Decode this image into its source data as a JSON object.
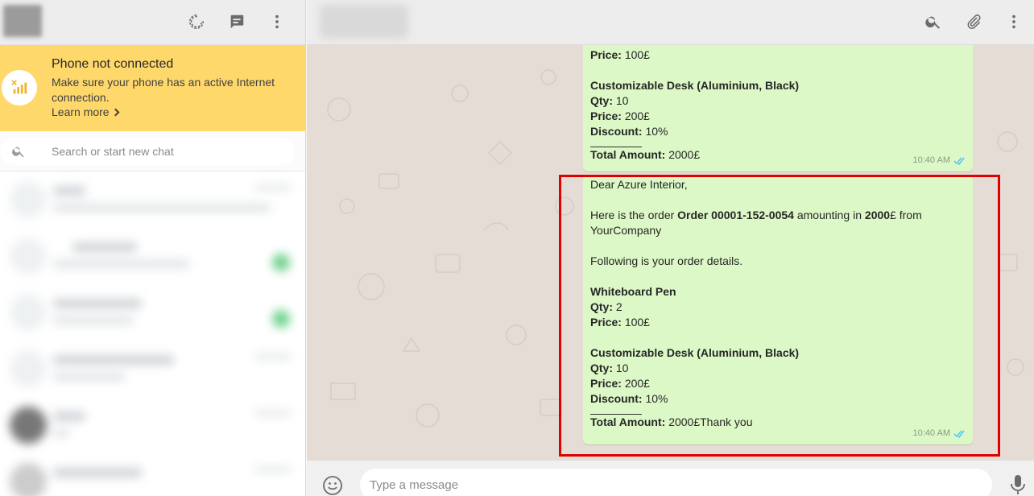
{
  "sidebar": {
    "notice": {
      "title": "Phone not connected",
      "body": "Make sure your phone has an active Internet connection.",
      "link": "Learn more"
    },
    "search": {
      "placeholder": "Search or start new chat"
    },
    "header_icons": [
      "status-icon",
      "new-chat-icon",
      "menu-icon"
    ]
  },
  "conversation": {
    "header_icons": [
      "search-icon",
      "attach-icon",
      "menu-icon"
    ],
    "messages": [
      {
        "price_top_label": "Price:",
        "price_top_value": "100£",
        "item2_name": "Customizable Desk (Aluminium, Black)",
        "qty_label": "Qty:",
        "qty_value": "10",
        "price_label": "Price:",
        "price_value": "200£",
        "discount_label": "Discount:",
        "discount_value": "10%",
        "total_label": "Total Amount:",
        "total_value": "2000£",
        "time": "10:40 AM"
      },
      {
        "greeting": "Dear Azure Interior,",
        "line1_pre": "Here is the order ",
        "order_ref": "Order 00001-152-0054",
        "line1_mid": " amounting in ",
        "amount": "2000",
        "line1_post": "£ from YourCompany",
        "details_intro": "Following is your order details.",
        "item1_name": "Whiteboard Pen",
        "item1_qty_label": "Qty:",
        "item1_qty_value": "2",
        "item1_price_label": "Price:",
        "item1_price_value": "100£",
        "item2_name": "Customizable Desk (Aluminium, Black)",
        "item2_qty_label": "Qty:",
        "item2_qty_value": "10",
        "item2_price_label": "Price:",
        "item2_price_value": "200£",
        "item2_discount_label": "Discount:",
        "item2_discount_value": "10%",
        "total_label": "Total Amount:",
        "total_value": "2000£Thank you",
        "time": "10:40 AM"
      }
    ],
    "composer": {
      "placeholder": "Type a message"
    }
  },
  "colors": {
    "outgoing_bubble": "#dcf8c6",
    "notice_bg": "#ffd86b",
    "highlight_border": "#e00000",
    "read_ticks": "#4fc3f7"
  }
}
